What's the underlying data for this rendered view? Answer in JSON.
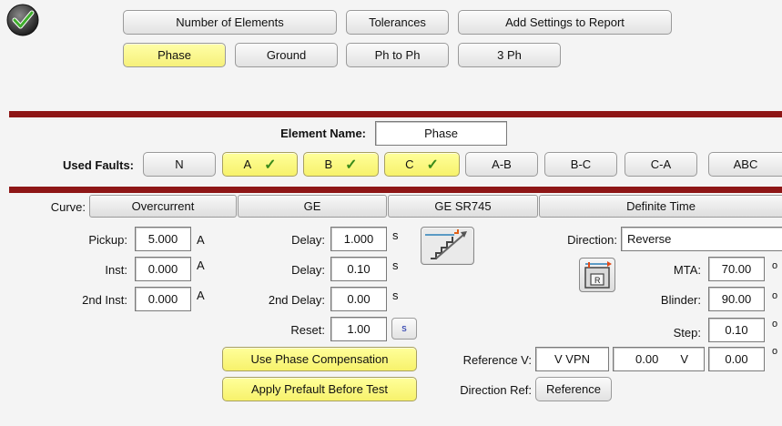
{
  "top_buttons": {
    "number_of_elements": "Number of Elements",
    "tolerances": "Tolerances",
    "add_settings": "Add Settings to Report"
  },
  "element_tabs": [
    "Phase",
    "Ground",
    "Ph to Ph",
    "3 Ph"
  ],
  "element_name": {
    "label": "Element Name:",
    "value": "Phase"
  },
  "used_faults": {
    "label": "Used Faults:",
    "faults": [
      {
        "label": "N",
        "checked": false
      },
      {
        "label": "A",
        "checked": true
      },
      {
        "label": "B",
        "checked": true
      },
      {
        "label": "C",
        "checked": true
      },
      {
        "label": "A-B",
        "checked": false
      },
      {
        "label": "B-C",
        "checked": false
      },
      {
        "label": "C-A",
        "checked": false
      },
      {
        "label": "ABC",
        "checked": false
      }
    ],
    "check_glyph": "✓"
  },
  "curve": {
    "label": "Curve:",
    "type": "Overcurrent",
    "manufacturer": "GE",
    "model": "GE SR745",
    "characteristic": "Definite Time"
  },
  "settings": {
    "pickup": {
      "label": "Pickup:",
      "value": "5.000",
      "unit": "A"
    },
    "inst": {
      "label": "Inst:",
      "value": "0.000",
      "unit": "A"
    },
    "inst2": {
      "label": "2nd Inst:",
      "value": "0.000",
      "unit": "A"
    },
    "delay1": {
      "label": "Delay:",
      "value": "1.000",
      "unit": "s"
    },
    "delay2": {
      "label": "Delay:",
      "value": "0.10",
      "unit": "s"
    },
    "delay_2nd": {
      "label": "2nd Delay:",
      "value": "0.00",
      "unit": "s"
    },
    "reset": {
      "label": "Reset:",
      "value": "1.00",
      "unit_button": "s"
    }
  },
  "direction": {
    "label": "Direction:",
    "value": "Reverse",
    "mta": {
      "label": "MTA:",
      "value": "70.00",
      "unit": "o"
    },
    "blinder": {
      "label": "Blinder:",
      "value": "90.00",
      "unit": "o"
    },
    "step": {
      "label": "Step:",
      "value": "0.10",
      "unit": "o"
    }
  },
  "reference": {
    "label": "Reference V:",
    "source": "V VPN",
    "magnitude": "0.00",
    "magnitude_unit": "V",
    "angle": "0.00",
    "angle_unit": "o",
    "dir_ref_label": "Direction Ref:",
    "dir_ref_button": "Reference"
  },
  "actions": {
    "phase_comp": "Use Phase Compensation",
    "prefault": "Apply Prefault Before Test"
  },
  "colors": {
    "accent_bar": "#8e1616",
    "yellow": "#f7f26c",
    "check": "#3a8a1a"
  },
  "icons": {
    "status": "checkmark-circle-icon",
    "staircase": "staircase-curve-icon",
    "direction": "direction-relay-icon"
  }
}
